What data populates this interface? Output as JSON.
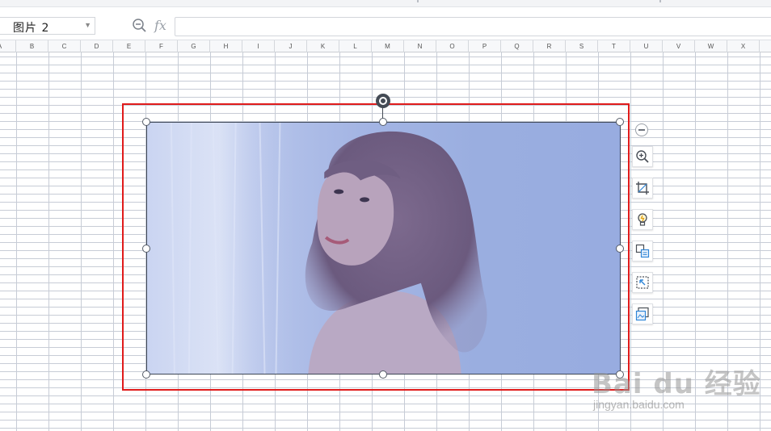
{
  "namebox": {
    "value": "图片 2"
  },
  "formula": {
    "fx_label": "fx",
    "value": ""
  },
  "columns": [
    "A",
    "B",
    "C",
    "D",
    "E",
    "F",
    "G",
    "H",
    "I",
    "J",
    "K",
    "L",
    "M",
    "N",
    "O",
    "P",
    "Q",
    "R",
    "S",
    "T",
    "U",
    "V",
    "W",
    "X"
  ],
  "picture_toolbar": {
    "tools": [
      "zoom-in-icon",
      "crop-icon",
      "lightbulb-icon",
      "image-to-text-icon",
      "select-region-icon",
      "insert-picture-icon"
    ]
  },
  "watermark": {
    "brand": "Bai du 经验",
    "url": "jingyan.baidu.com"
  },
  "colors": {
    "selection_frame": "#e01b1b",
    "grid_line": "#c7ccd6",
    "picture_tint": "#9aaee0"
  }
}
